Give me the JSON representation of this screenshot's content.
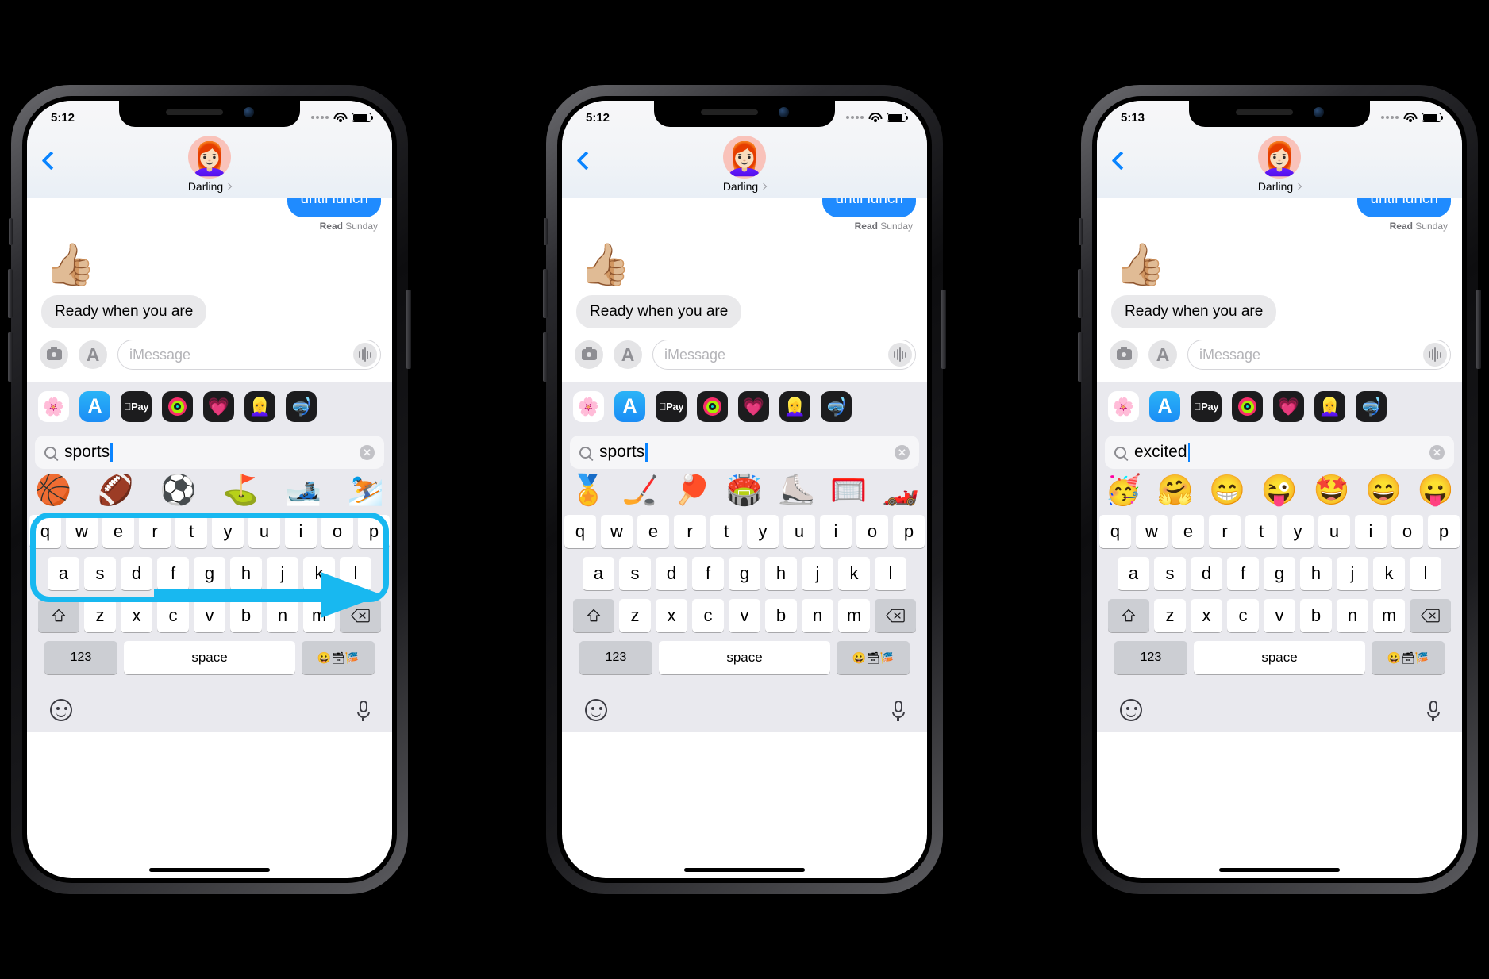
{
  "title": "iOS Messages emoji search — three iPhone screenshots",
  "colors": {
    "accent_blue": "#1f8bff",
    "highlight_cyan": "#18b8f0",
    "bubble_in_gray": "#e9e9eb",
    "panel_gray": "#e9e9ee",
    "key_white": "#ffffff",
    "key_gray": "#ccced3"
  },
  "phones": [
    {
      "id": "phone-1",
      "status": {
        "time": "5:12",
        "wifi": "wifi-icon",
        "battery": "battery-icon",
        "signal": "signal-dots"
      },
      "nav": {
        "back": "back-chevron-icon",
        "avatar": "memoji-avatar",
        "name": "Darling",
        "name_chevron": "chevron-right-icon"
      },
      "conversation": {
        "outgoing_partial": "until lunch",
        "read_label": "Read",
        "read_day": "Sunday",
        "reaction": "👍🏼",
        "incoming": "Ready when you are"
      },
      "input": {
        "camera": "camera-icon",
        "appstore": "app-store-icon",
        "placeholder": "iMessage",
        "audio": "audio-waveform-icon"
      },
      "apps": [
        {
          "name": "photos",
          "glyph": "🌸"
        },
        {
          "name": "app-store",
          "glyph": "A"
        },
        {
          "name": "apple-pay",
          "glyph": "Pay"
        },
        {
          "name": "fitness",
          "glyph": "rings"
        },
        {
          "name": "health",
          "glyph": "💗"
        },
        {
          "name": "memoji",
          "glyph": "👱‍♀️"
        },
        {
          "name": "memoji-sticker",
          "glyph": "🤿"
        }
      ],
      "search": {
        "query": "sports",
        "icon": "search-icon",
        "clear": "clear-icon"
      },
      "emoji_results": [
        "🏀",
        "🏈",
        "⚽",
        "⛳",
        "🎿",
        "⛷️"
      ],
      "highlight": true,
      "annotation_arrow": "right-arrow-annotation"
    },
    {
      "id": "phone-2",
      "status": {
        "time": "5:12",
        "wifi": "wifi-icon",
        "battery": "battery-icon",
        "signal": "signal-dots"
      },
      "nav": {
        "back": "back-chevron-icon",
        "avatar": "memoji-avatar",
        "name": "Darling",
        "name_chevron": "chevron-right-icon"
      },
      "conversation": {
        "outgoing_partial": "until lunch",
        "read_label": "Read",
        "read_day": "Sunday",
        "reaction": "👍🏼",
        "incoming": "Ready when you are"
      },
      "input": {
        "camera": "camera-icon",
        "appstore": "app-store-icon",
        "placeholder": "iMessage",
        "audio": "audio-waveform-icon"
      },
      "apps": [
        {
          "name": "photos",
          "glyph": "🌸"
        },
        {
          "name": "app-store",
          "glyph": "A"
        },
        {
          "name": "apple-pay",
          "glyph": "Pay"
        },
        {
          "name": "fitness",
          "glyph": "rings"
        },
        {
          "name": "health",
          "glyph": "💗"
        },
        {
          "name": "memoji",
          "glyph": "👱‍♀️"
        },
        {
          "name": "memoji-sticker",
          "glyph": "🤿"
        }
      ],
      "search": {
        "query": "sports",
        "icon": "search-icon",
        "clear": "clear-icon"
      },
      "emoji_results": [
        "🏅",
        "🏒",
        "🏓",
        "🏟️",
        "⛸️",
        "🥅",
        "🏎️"
      ],
      "highlight": false,
      "annotation_arrow": null
    },
    {
      "id": "phone-3",
      "status": {
        "time": "5:13",
        "wifi": "wifi-icon",
        "battery": "battery-icon",
        "signal": "signal-dots"
      },
      "nav": {
        "back": "back-chevron-icon",
        "avatar": "memoji-avatar",
        "name": "Darling",
        "name_chevron": "chevron-right-icon"
      },
      "conversation": {
        "outgoing_partial": "until lunch",
        "read_label": "Read",
        "read_day": "Sunday",
        "reaction": "👍🏼",
        "incoming": "Ready when you are"
      },
      "input": {
        "camera": "camera-icon",
        "appstore": "app-store-icon",
        "placeholder": "iMessage",
        "audio": "audio-waveform-icon"
      },
      "apps": [
        {
          "name": "photos",
          "glyph": "🌸"
        },
        {
          "name": "app-store",
          "glyph": "A"
        },
        {
          "name": "apple-pay",
          "glyph": "Pay"
        },
        {
          "name": "fitness",
          "glyph": "rings"
        },
        {
          "name": "health",
          "glyph": "💗"
        },
        {
          "name": "memoji",
          "glyph": "👱‍♀️"
        },
        {
          "name": "memoji-sticker",
          "glyph": "🤿"
        }
      ],
      "search": {
        "query": "excited",
        "icon": "search-icon",
        "clear": "clear-icon"
      },
      "emoji_results": [
        "🥳",
        "🤗",
        "😁",
        "😜",
        "🤩",
        "😄",
        "😛"
      ],
      "highlight": false,
      "annotation_arrow": null
    }
  ],
  "keyboard": {
    "row1": [
      "q",
      "w",
      "e",
      "r",
      "t",
      "y",
      "u",
      "i",
      "o",
      "p"
    ],
    "row2": [
      "a",
      "s",
      "d",
      "f",
      "g",
      "h",
      "j",
      "k",
      "l"
    ],
    "row3": [
      "z",
      "x",
      "c",
      "v",
      "b",
      "n",
      "m"
    ],
    "shift": "shift-icon",
    "delete": "delete-icon",
    "numbers_label": "123",
    "space_label": "space",
    "emoji_switch": "😀🗃🎏",
    "globe_smiley": "emoji-keyboard-icon",
    "dictation": "microphone-icon"
  }
}
